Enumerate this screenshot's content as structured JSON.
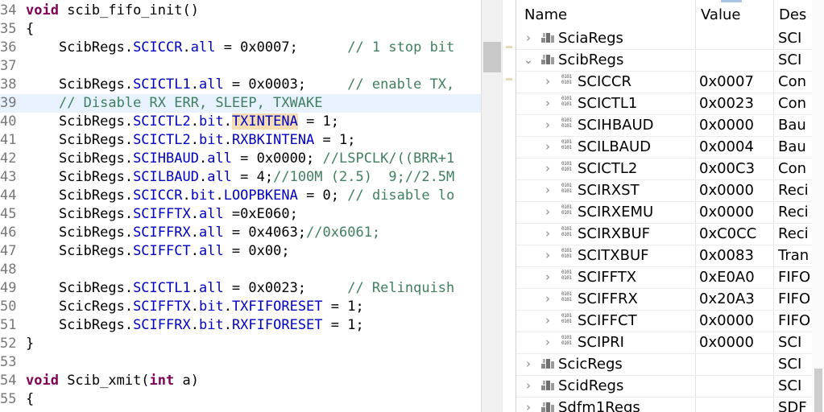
{
  "editor": {
    "lines": [
      {
        "num": "34",
        "tokens": [
          {
            "t": "void",
            "c": "kw"
          },
          {
            "t": " scib_fifo_init()",
            "c": "pl"
          }
        ]
      },
      {
        "num": "35",
        "tokens": [
          {
            "t": "{",
            "c": "pl"
          }
        ]
      },
      {
        "num": "36",
        "tokens": [
          {
            "t": "    ScibRegs.",
            "c": "pl"
          },
          {
            "t": "SCICCR",
            "c": "fld"
          },
          {
            "t": ".",
            "c": "pl"
          },
          {
            "t": "all",
            "c": "fld"
          },
          {
            "t": " = 0x0007;      ",
            "c": "pl"
          },
          {
            "t": "// 1 stop bit",
            "c": "cm"
          }
        ]
      },
      {
        "num": "37",
        "tokens": []
      },
      {
        "num": "38",
        "tokens": [
          {
            "t": "    ScibRegs.",
            "c": "pl"
          },
          {
            "t": "SCICTL1",
            "c": "fld"
          },
          {
            "t": ".",
            "c": "pl"
          },
          {
            "t": "all",
            "c": "fld"
          },
          {
            "t": " = 0x0003;     ",
            "c": "pl"
          },
          {
            "t": "// enable TX,",
            "c": "cm"
          }
        ]
      },
      {
        "num": "39",
        "current": true,
        "tokens": [
          {
            "t": "    ",
            "c": "pl"
          },
          {
            "t": "// Disable RX ERR, SLEEP, TXWAKE",
            "c": "cm"
          }
        ]
      },
      {
        "num": "40",
        "tokens": [
          {
            "t": "    ScibRegs.",
            "c": "pl"
          },
          {
            "t": "SCICTL2",
            "c": "fld"
          },
          {
            "t": ".",
            "c": "pl"
          },
          {
            "t": "bit",
            "c": "fld"
          },
          {
            "t": ".",
            "c": "pl"
          },
          {
            "t": "TXINTENA",
            "c": "fld",
            "hl": true
          },
          {
            "t": " = 1;",
            "c": "pl"
          }
        ]
      },
      {
        "num": "41",
        "tokens": [
          {
            "t": "    ScibRegs.",
            "c": "pl"
          },
          {
            "t": "SCICTL2",
            "c": "fld"
          },
          {
            "t": ".",
            "c": "pl"
          },
          {
            "t": "bit",
            "c": "fld"
          },
          {
            "t": ".",
            "c": "pl"
          },
          {
            "t": "RXBKINTENA",
            "c": "fld"
          },
          {
            "t": " = 1;",
            "c": "pl"
          }
        ]
      },
      {
        "num": "42",
        "tokens": [
          {
            "t": "    ScibRegs.",
            "c": "pl"
          },
          {
            "t": "SCIHBAUD",
            "c": "fld"
          },
          {
            "t": ".",
            "c": "pl"
          },
          {
            "t": "all",
            "c": "fld"
          },
          {
            "t": " = 0x0000; ",
            "c": "pl"
          },
          {
            "t": "//LSPCLK/((BRR+1",
            "c": "cm"
          }
        ]
      },
      {
        "num": "43",
        "tokens": [
          {
            "t": "    ScibRegs.",
            "c": "pl"
          },
          {
            "t": "SCILBAUD",
            "c": "fld"
          },
          {
            "t": ".",
            "c": "pl"
          },
          {
            "t": "all",
            "c": "fld"
          },
          {
            "t": " = 4;",
            "c": "pl"
          },
          {
            "t": "//100M (2.5)  9;//2.5M",
            "c": "cm"
          }
        ]
      },
      {
        "num": "44",
        "tokens": [
          {
            "t": "    ScibRegs.",
            "c": "pl"
          },
          {
            "t": "SCICCR",
            "c": "fld"
          },
          {
            "t": ".",
            "c": "pl"
          },
          {
            "t": "bit",
            "c": "fld"
          },
          {
            "t": ".",
            "c": "pl"
          },
          {
            "t": "LOOPBKENA",
            "c": "fld"
          },
          {
            "t": " = 0; ",
            "c": "pl"
          },
          {
            "t": "// disable lo",
            "c": "cm"
          }
        ]
      },
      {
        "num": "45",
        "tokens": [
          {
            "t": "    ScibRegs.",
            "c": "pl"
          },
          {
            "t": "SCIFFTX",
            "c": "fld"
          },
          {
            "t": ".",
            "c": "pl"
          },
          {
            "t": "all",
            "c": "fld"
          },
          {
            "t": " =0xE060;",
            "c": "pl"
          }
        ]
      },
      {
        "num": "46",
        "tokens": [
          {
            "t": "    ScibRegs.",
            "c": "pl"
          },
          {
            "t": "SCIFFRX",
            "c": "fld"
          },
          {
            "t": ".",
            "c": "pl"
          },
          {
            "t": "all",
            "c": "fld"
          },
          {
            "t": " = 0x4063;",
            "c": "pl"
          },
          {
            "t": "//0x6061;",
            "c": "cm"
          }
        ]
      },
      {
        "num": "47",
        "tokens": [
          {
            "t": "    ScibRegs.",
            "c": "pl"
          },
          {
            "t": "SCIFFCT",
            "c": "fld"
          },
          {
            "t": ".",
            "c": "pl"
          },
          {
            "t": "all",
            "c": "fld"
          },
          {
            "t": " = 0x00;",
            "c": "pl"
          }
        ]
      },
      {
        "num": "48",
        "tokens": []
      },
      {
        "num": "49",
        "tokens": [
          {
            "t": "    ScibRegs.",
            "c": "pl"
          },
          {
            "t": "SCICTL1",
            "c": "fld"
          },
          {
            "t": ".",
            "c": "pl"
          },
          {
            "t": "all",
            "c": "fld"
          },
          {
            "t": " = 0x0023;     ",
            "c": "pl"
          },
          {
            "t": "// Relinquish",
            "c": "cm"
          }
        ]
      },
      {
        "num": "50",
        "tokens": [
          {
            "t": "    ScicRegs.",
            "c": "pl"
          },
          {
            "t": "SCIFFTX",
            "c": "fld"
          },
          {
            "t": ".",
            "c": "pl"
          },
          {
            "t": "bit",
            "c": "fld"
          },
          {
            "t": ".",
            "c": "pl"
          },
          {
            "t": "TXFIFORESET",
            "c": "fld"
          },
          {
            "t": " = 1;",
            "c": "pl"
          }
        ]
      },
      {
        "num": "51",
        "tokens": [
          {
            "t": "    ScibRegs.",
            "c": "pl"
          },
          {
            "t": "SCIFFRX",
            "c": "fld"
          },
          {
            "t": ".",
            "c": "pl"
          },
          {
            "t": "bit",
            "c": "fld"
          },
          {
            "t": ".",
            "c": "pl"
          },
          {
            "t": "RXFIFORESET",
            "c": "fld"
          },
          {
            "t": " = 1;",
            "c": "pl"
          }
        ]
      },
      {
        "num": "52",
        "tokens": [
          {
            "t": "}",
            "c": "pl"
          }
        ]
      },
      {
        "num": "53",
        "tokens": []
      },
      {
        "num": "54",
        "tokens": [
          {
            "t": "void",
            "c": "kw"
          },
          {
            "t": " Scib_xmit(",
            "c": "pl"
          },
          {
            "t": "int",
            "c": "kw"
          },
          {
            "t": " a)",
            "c": "pl"
          }
        ]
      },
      {
        "num": "55",
        "tokens": [
          {
            "t": "{",
            "c": "pl"
          }
        ]
      }
    ]
  },
  "registers": {
    "columns": {
      "name": "Name",
      "value": "Value",
      "desc": "Des"
    },
    "rows": [
      {
        "level": 0,
        "chevron": "›",
        "name": "SciaRegs",
        "value": "",
        "desc": "SCI",
        "type": "group"
      },
      {
        "level": 0,
        "chevron": "⌄",
        "name": "ScibRegs",
        "value": "",
        "desc": "SCI",
        "type": "group"
      },
      {
        "level": 1,
        "chevron": "›",
        "name": "SCICCR",
        "value": "0x0007",
        "desc": "Con",
        "type": "reg"
      },
      {
        "level": 1,
        "chevron": "›",
        "name": "SCICTL1",
        "value": "0x0023",
        "desc": "Con",
        "type": "reg"
      },
      {
        "level": 1,
        "chevron": "›",
        "name": "SCIHBAUD",
        "value": "0x0000",
        "desc": "Bau",
        "type": "reg"
      },
      {
        "level": 1,
        "chevron": "›",
        "name": "SCILBAUD",
        "value": "0x0004",
        "desc": "Bau",
        "type": "reg"
      },
      {
        "level": 1,
        "chevron": "›",
        "name": "SCICTL2",
        "value": "0x00C3",
        "desc": "Con",
        "type": "reg"
      },
      {
        "level": 1,
        "chevron": "›",
        "name": "SCIRXST",
        "value": "0x0000",
        "desc": "Reci",
        "type": "reg"
      },
      {
        "level": 1,
        "chevron": "›",
        "name": "SCIRXEMU",
        "value": "0x0000",
        "desc": "Reci",
        "type": "reg"
      },
      {
        "level": 1,
        "chevron": "›",
        "name": "SCIRXBUF",
        "value": "0xC0CC",
        "desc": "Reci",
        "type": "reg"
      },
      {
        "level": 1,
        "chevron": "›",
        "name": "SCITXBUF",
        "value": "0x0083",
        "desc": "Tran",
        "type": "reg"
      },
      {
        "level": 1,
        "chevron": "›",
        "name": "SCIFFTX",
        "value": "0xE0A0",
        "desc": "FIFO",
        "type": "reg"
      },
      {
        "level": 1,
        "chevron": "›",
        "name": "SCIFFRX",
        "value": "0x20A3",
        "desc": "FIFO",
        "type": "reg"
      },
      {
        "level": 1,
        "chevron": "›",
        "name": "SCIFFCT",
        "value": "0x0000",
        "desc": "FIFO",
        "type": "reg"
      },
      {
        "level": 1,
        "chevron": "›",
        "name": "SCIPRI",
        "value": "0x0000",
        "desc": "SCI",
        "type": "reg"
      },
      {
        "level": 0,
        "chevron": "›",
        "name": "ScicRegs",
        "value": "",
        "desc": "SCI",
        "type": "group"
      },
      {
        "level": 0,
        "chevron": "›",
        "name": "ScidRegs",
        "value": "",
        "desc": "SCI",
        "type": "group"
      },
      {
        "level": 0,
        "chevron": "›",
        "name": "Sdfm1Regs",
        "value": "",
        "desc": "SDF",
        "type": "group"
      }
    ],
    "reg_icon_text": "0101\n0101"
  }
}
